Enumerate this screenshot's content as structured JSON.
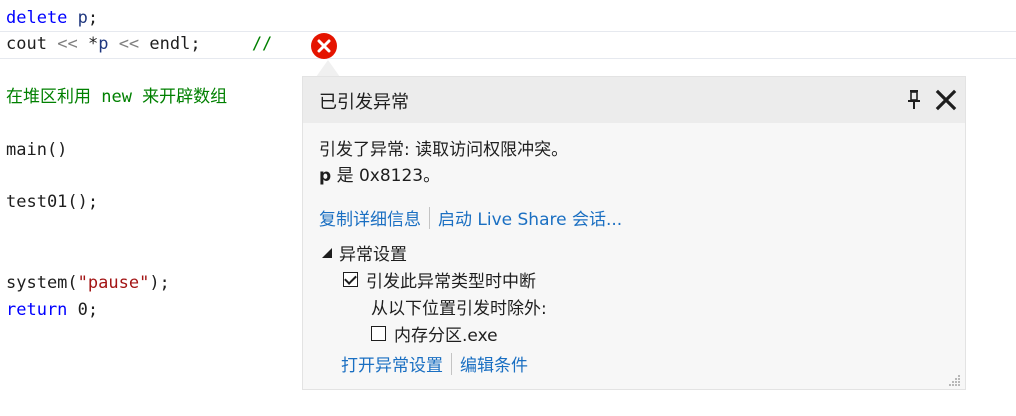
{
  "editor": {
    "line1": {
      "kw": "delete",
      "var": "p",
      "end": ";"
    },
    "line2": {
      "cout": "cout",
      "op1": "<<",
      "deref": "*",
      "var": "p",
      "op2": "<<",
      "endl": "endl",
      "semi": ";",
      "comment": "//"
    },
    "comment_line": "在堆区利用 new 来开辟数组",
    "main_line": "main()",
    "test_line": "test01();",
    "system_line": {
      "fn": "system(",
      "str": "\"pause\"",
      "end": ");"
    },
    "return_line": {
      "kw": "return",
      "rest": " 0;"
    }
  },
  "popup": {
    "title": "已引发异常",
    "message": "引发了异常: 读取访问权限冲突。",
    "detail_name": "p",
    "detail_rest": " 是 0x8123。",
    "copy_details_link": "复制详细信息",
    "live_share_link": "启动 Live Share 会话...",
    "section_title": "异常设置",
    "break_checkbox_label": "引发此异常类型时中断",
    "break_checked": true,
    "except_label": "从以下位置引发时除外:",
    "module_checkbox_label": "内存分区.exe",
    "module_checked": false,
    "open_settings_link": "打开异常设置",
    "edit_conditions_link": "编辑条件"
  },
  "colors": {
    "error": "#e51400",
    "link": "#1a6fc2",
    "keyword": "#0000ff",
    "comment": "#008000",
    "string": "#a31515"
  }
}
